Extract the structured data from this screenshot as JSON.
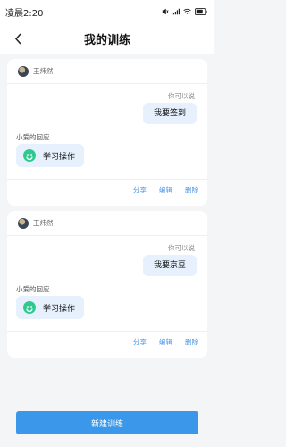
{
  "status_bar": {
    "time": "凌晨2:20"
  },
  "nav": {
    "title": "我的训练"
  },
  "cards": [
    {
      "user": "王炜然",
      "hint": "你可以说",
      "command": "我要签到",
      "reply_label": "小爱的回应",
      "reply": "学习操作",
      "actions": {
        "share": "分享",
        "edit": "编辑",
        "delete": "删除"
      }
    },
    {
      "user": "王炜然",
      "hint": "你可以说",
      "command": "我要京豆",
      "reply_label": "小爱的回应",
      "reply": "学习操作",
      "actions": {
        "share": "分享",
        "edit": "编辑",
        "delete": "删除"
      }
    }
  ],
  "footer": {
    "new_button_label": "新建训练"
  },
  "colors": {
    "accent": "#3a97ea",
    "bubble": "#e6f1fd",
    "bot_icon": "#2fc98f",
    "action_link": "#3a8ee6"
  }
}
